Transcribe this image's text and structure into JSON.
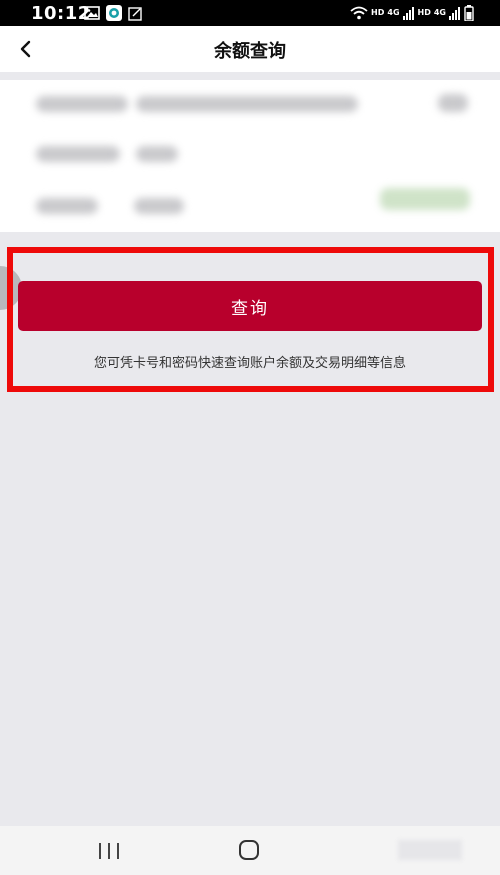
{
  "status_bar": {
    "time": "10:12",
    "right_icons": [
      "wifi-icon",
      "hd-4g-signal-icon",
      "hd-4g-signal-icon",
      "battery-icon"
    ],
    "hd1": "HD",
    "net1": "4G",
    "hd2": "HD",
    "net2": "4G"
  },
  "nav": {
    "title": "余额查询"
  },
  "query": {
    "button_label": "查询",
    "hint": "您可凭卡号和密码快速查询账户余额及交易明细等信息"
  },
  "colors": {
    "accent": "#b8002c",
    "highlight": "#ee0a0a",
    "background": "#e9e9ed"
  }
}
